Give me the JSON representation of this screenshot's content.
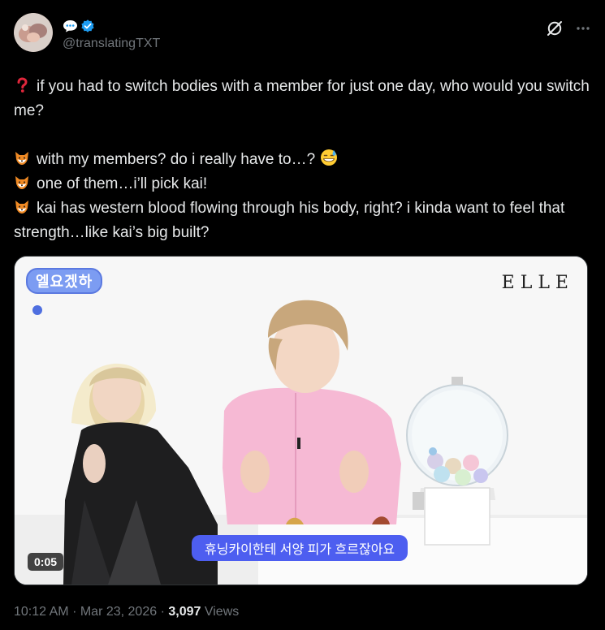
{
  "user": {
    "handle": "@translatingTXT",
    "avatar_icon": "avatar-photo",
    "verified_icon": "verified-badge-icon",
    "verified_color": "#1d9bf0"
  },
  "header_actions": {
    "grok_icon": "grok-icon",
    "more_icon": "more-options-icon"
  },
  "tweet": {
    "lines": [
      {
        "icon": "red-question-mark-icon",
        "text": "if you had to switch bodies with a member for just one day, who would you switch me?"
      },
      {
        "icon": "fox-face-icon",
        "text": "with my members? do i really have to…?",
        "trailing_icon": "grinning-sweat-icon"
      },
      {
        "icon": "fox-face-icon",
        "text": "one of them…i’ll pick kai!"
      },
      {
        "icon": "fox-face-icon",
        "text": "kai has western blood flowing through his body, right? i kinda want to feel that strength…like kai’s big built?"
      }
    ]
  },
  "media": {
    "brand": "ELLE",
    "show_logo": "엘요겠하",
    "subtitle": "휴닝카이한테 서양 피가 흐르잖아요",
    "duration": "0:05",
    "subtitle_bg": "#4d5ef0"
  },
  "meta": {
    "time": "10:12 AM",
    "separator": "·",
    "date": "Mar 23, 2026",
    "views_count": "3,097",
    "views_label": "Views"
  },
  "colors": {
    "background": "#000000",
    "text": "#e7e9ea",
    "secondary_text": "#71767b"
  }
}
